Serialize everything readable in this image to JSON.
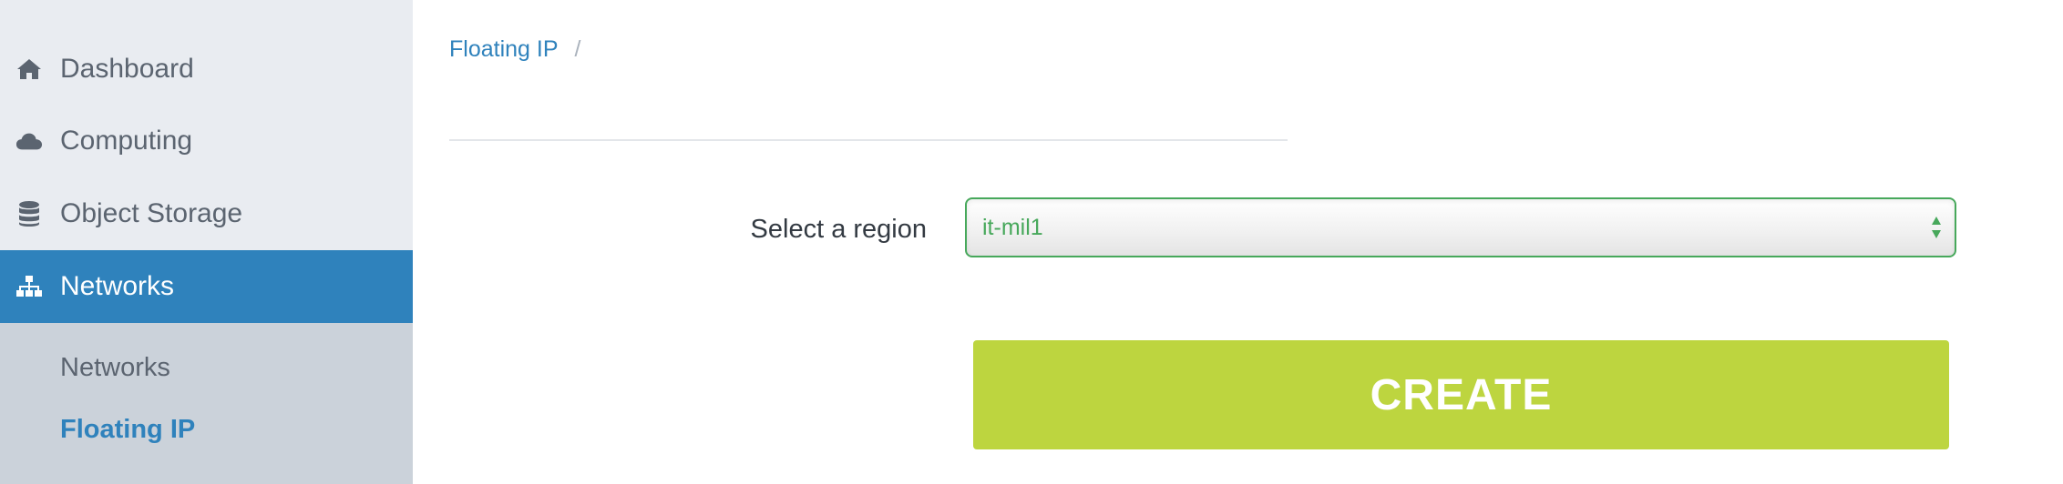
{
  "sidebar": {
    "items": [
      {
        "label": "Dashboard",
        "icon": "home-icon"
      },
      {
        "label": "Computing",
        "icon": "cloud-icon"
      },
      {
        "label": "Object Storage",
        "icon": "database-icon"
      },
      {
        "label": "Networks",
        "icon": "sitemap-icon",
        "active": true
      }
    ],
    "subitems": [
      {
        "label": "Networks"
      },
      {
        "label": "Floating IP",
        "active": true
      }
    ]
  },
  "breadcrumb": {
    "current": "Floating IP",
    "separator": "/"
  },
  "form": {
    "region_label": "Select a region",
    "region_value": "it-mil1",
    "create_label": "CREATE"
  },
  "colors": {
    "sidebar_bg": "#e9ecf1",
    "active_bg": "#2f82bc",
    "subnav_bg": "#cbd2da",
    "select_border": "#47a85b",
    "create_bg": "#bdd53f"
  }
}
